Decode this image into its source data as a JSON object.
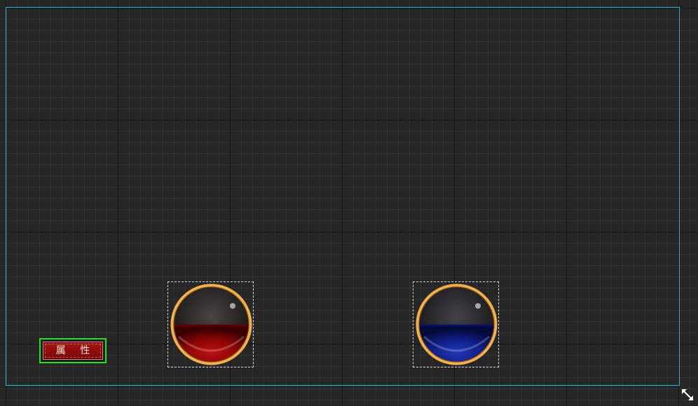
{
  "canvas": {
    "grid_major_color": "#141414",
    "grid_minor_color": "#333333",
    "background_color": "#262626",
    "bounds_color": "#22b8e0"
  },
  "widgets": {
    "attribute_button": {
      "label": "属 性",
      "bg_color": "#8b0a0a",
      "selected_outline_color": "#22e022"
    },
    "health_orb": {
      "fill_color": "#9b0a0a",
      "rim_color": "#e0a040",
      "fill_level": 0.5
    },
    "mana_orb": {
      "fill_color": "#10208a",
      "rim_color": "#e0a040",
      "fill_level": 0.5
    }
  },
  "icons": {
    "resize_handle": "resize-diagonal-icon"
  }
}
